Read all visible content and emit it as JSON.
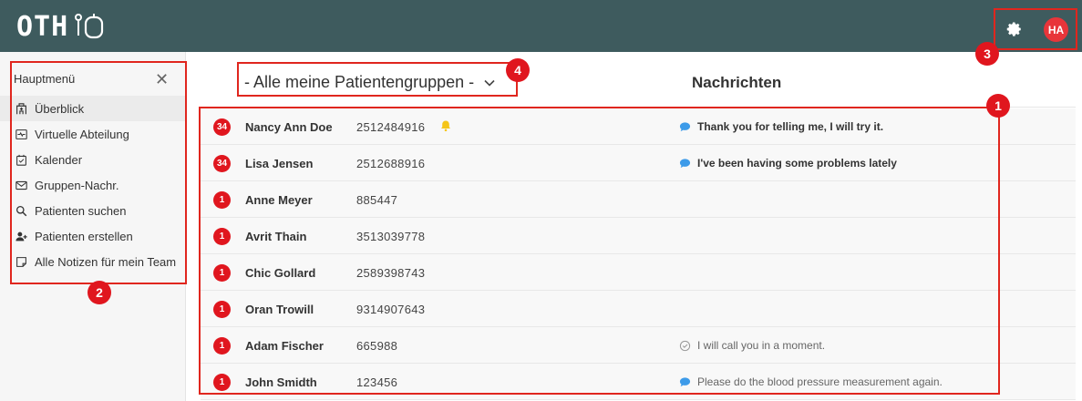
{
  "app": {
    "logo_text": "OTH"
  },
  "user": {
    "initials": "HA"
  },
  "sidebar": {
    "title": "Hauptmenü",
    "close_glyph": "✕",
    "items": [
      {
        "label": "Überblick",
        "icon": "hospital-icon"
      },
      {
        "label": "Virtuelle Abteilung",
        "icon": "monitor-pulse-icon"
      },
      {
        "label": "Kalender",
        "icon": "calendar-check-icon"
      },
      {
        "label": "Gruppen-Nachr.",
        "icon": "envelope-icon"
      },
      {
        "label": "Patienten suchen",
        "icon": "search-icon"
      },
      {
        "label": "Patienten erstellen",
        "icon": "user-plus-icon"
      },
      {
        "label": "Alle Notizen für mein Team",
        "icon": "note-icon"
      }
    ]
  },
  "main": {
    "group_selector": "- Alle meine Patientengruppen -",
    "messages_header": "Nachrichten"
  },
  "patients": [
    {
      "badge": "34",
      "name": "Nancy Ann Doe",
      "id": "2512484916",
      "bell": true,
      "message": "Thank you for telling me, I will try it.",
      "msg_style": "unread"
    },
    {
      "badge": "34",
      "name": "Lisa Jensen",
      "id": "2512688916",
      "bell": false,
      "message": "I've been having some problems lately",
      "msg_style": "unread"
    },
    {
      "badge": "1",
      "name": "Anne Meyer",
      "id": "885447",
      "bell": false,
      "message": "",
      "msg_style": "none"
    },
    {
      "badge": "1",
      "name": "Avrit Thain",
      "id": "3513039778",
      "bell": false,
      "message": "",
      "msg_style": "none"
    },
    {
      "badge": "1",
      "name": "Chic Gollard",
      "id": "2589398743",
      "bell": false,
      "message": "",
      "msg_style": "none"
    },
    {
      "badge": "1",
      "name": "Oran Trowill",
      "id": "9314907643",
      "bell": false,
      "message": "",
      "msg_style": "none"
    },
    {
      "badge": "1",
      "name": "Adam Fischer",
      "id": "665988",
      "bell": false,
      "message": "I will call you in a moment.",
      "msg_style": "read"
    },
    {
      "badge": "1",
      "name": "John Smidth",
      "id": "123456",
      "bell": false,
      "message": "Please do the blood pressure measurement again.",
      "msg_style": "light-unread"
    }
  ],
  "annotations": [
    "1",
    "2",
    "3",
    "4"
  ],
  "colors": {
    "topbar": "#3e5b5e",
    "accent_red": "#e0161e",
    "chat_blue": "#3d9be9",
    "bell_yellow": "#f5c518"
  }
}
